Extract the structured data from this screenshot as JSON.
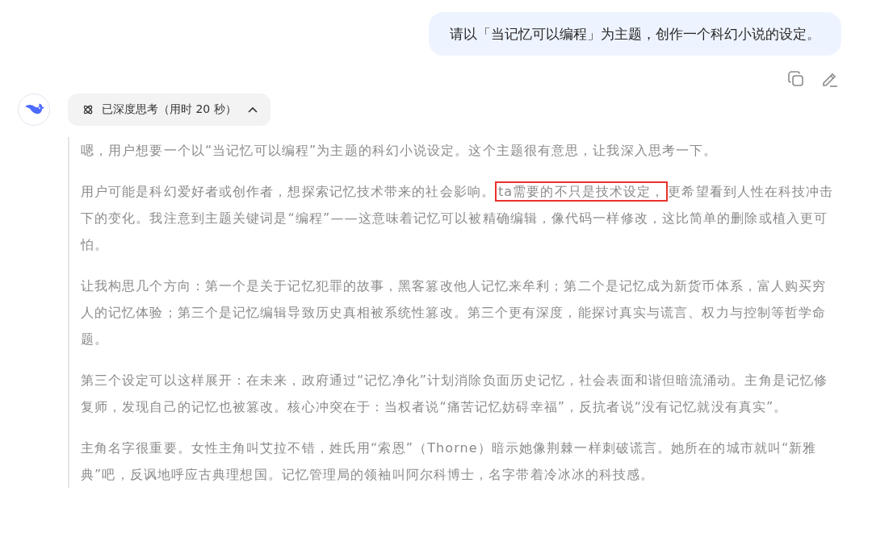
{
  "user_message": {
    "text": "请以「当记忆可以编程」为主题，创作一个科幻小说的设定。"
  },
  "thinking": {
    "label": "已深度思考（用时 20 秒）",
    "expanded": true
  },
  "paragraphs": [
    {
      "segments": [
        {
          "text": "嗯，用户想要一个以“当记忆可以编程”为主题的科幻小说设定。这个主题很有意思，让我深入思考一下。",
          "highlighted": false
        }
      ]
    },
    {
      "segments": [
        {
          "text": "用户可能是科幻爱好者或创作者，想探索记忆技术带来的社会影响。",
          "highlighted": false
        },
        {
          "text": "ta需要的不只是技术设定，",
          "highlighted": true
        },
        {
          "text": "更希望看到人性在科技冲击下的变化。我注意到主题关键词是“编程”——这意味着记忆可以被精确编辑，像代码一样修改，这比简单的删除或植入更可怕。",
          "highlighted": false
        }
      ]
    },
    {
      "segments": [
        {
          "text": "让我构思几个方向：第一个是关于记忆犯罪的故事，黑客篡改他人记忆来牟利；第二个是记忆成为新货币体系，富人购买穷人的记忆体验；第三个是记忆编辑导致历史真相被系统性篡改。第三个更有深度，能探讨真实与谎言、权力与控制等哲学命题。",
          "highlighted": false
        }
      ]
    },
    {
      "segments": [
        {
          "text": "第三个设定可以这样展开：在未来，政府通过“记忆净化”计划消除负面历史记忆，社会表面和谐但暗流涌动。主角是记忆修复师，发现自己的记忆也被篡改。核心冲突在于：当权者说“痛苦记忆妨碍幸福”，反抗者说“没有记忆就没有真实”。",
          "highlighted": false
        }
      ]
    },
    {
      "segments": [
        {
          "text": "主角名字很重要。女性主角叫艾拉不错，姓氏用“索恩”（Thorne）暗示她像荆棘一样刺破谎言。她所在的城市就叫“新雅典”吧，反讽地呼应古典理想国。记忆管理局的领袖叫阿尔科博士，名字带着冷冰冰的科技感。",
          "highlighted": false
        }
      ]
    }
  ]
}
